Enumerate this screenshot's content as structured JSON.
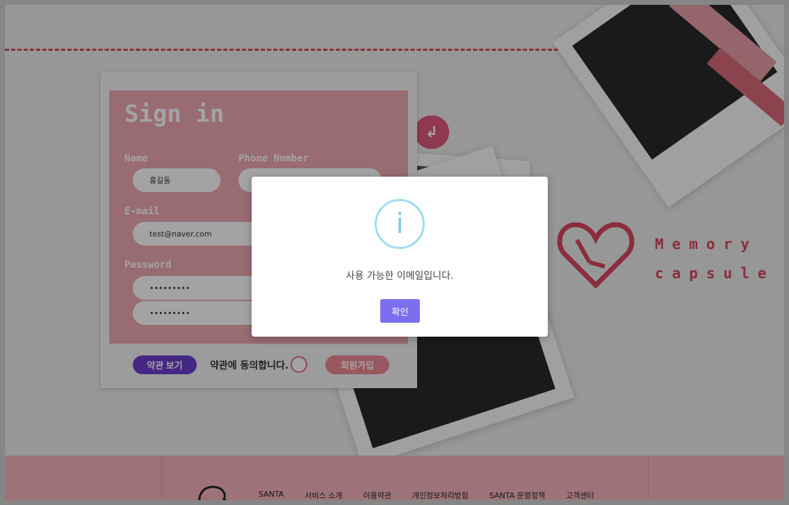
{
  "background": {
    "back_icon": "↲",
    "brand_line1": "Memory",
    "brand_line2": "capsule"
  },
  "signin": {
    "title": "Sign in",
    "name_label": "Name",
    "name_value": "홍길동",
    "phone_label": "Phone Number",
    "phone_value": "",
    "email_label": "E-mail",
    "email_value": "test@naver.com",
    "password_label": "Password",
    "password_value": "•••••••••",
    "password_confirm_value": "•••••••••",
    "terms_button": "약관 보기",
    "agree_text": "약관에 동의합니다.",
    "join_button": "회원가입"
  },
  "footer": {
    "nav": [
      "SANTA",
      "서비스 소개",
      "이용약관",
      "개인정보처리방침",
      "SANTA 운영정책",
      "고객센터"
    ]
  },
  "modal": {
    "icon": "i",
    "message": "사용 가능한 이메일입니다.",
    "confirm_button": "확인"
  },
  "colors": {
    "accent_pink": "#d9475e",
    "card_pink": "#f0a9b3",
    "terms_purple": "#6c3fd0",
    "modal_button": "#7b6ff0",
    "info_icon": "#9fdcf0"
  }
}
